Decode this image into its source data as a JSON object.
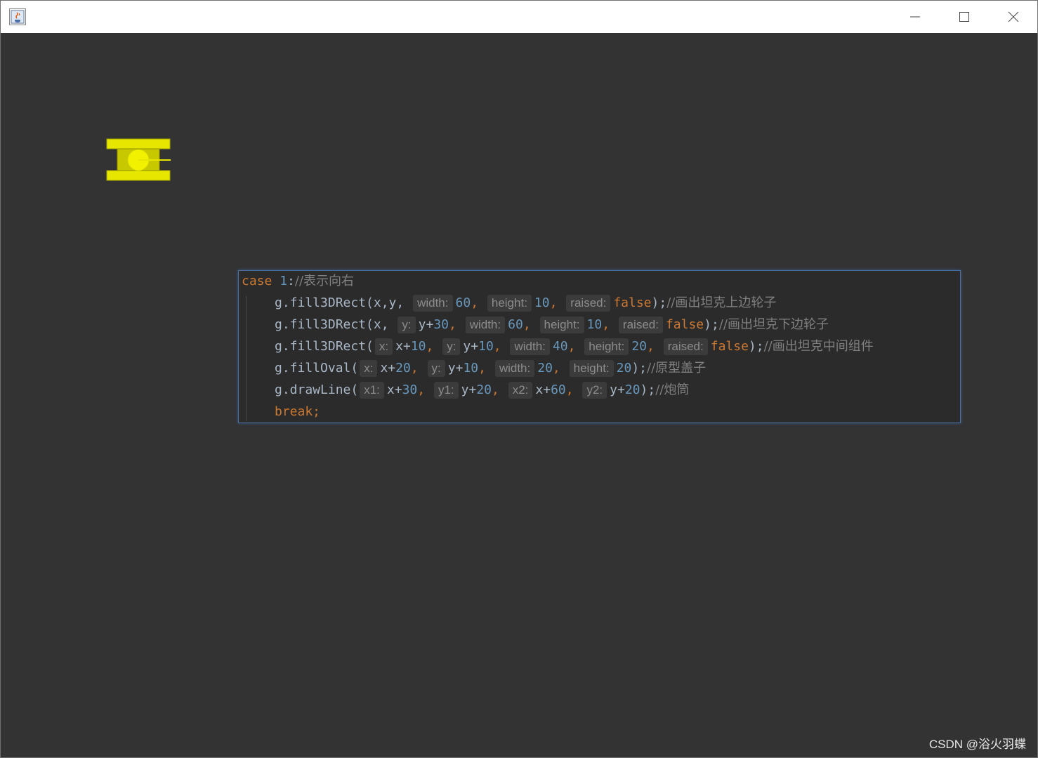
{
  "window": {
    "title": "",
    "icon": "java-coffee-icon",
    "controls": [
      "minimize-icon",
      "maximize-icon",
      "close-icon"
    ]
  },
  "colors": {
    "canvas_bg": "#333333",
    "tank_yellow": "#e6e600",
    "tank_dark": "#b8b800",
    "code_bg": "#2b2b2b",
    "keyword": "#cc7832",
    "number": "#6897bb",
    "comment": "#808080"
  },
  "code": {
    "l1": {
      "kw": "case",
      "num": "1",
      "colon": ":",
      "comment": "//表示向右"
    },
    "l2": {
      "call": "g.fill3DRect(x,y,",
      "h_width": "width:",
      "v_width": "60",
      "sep1": ",",
      "h_height": "height:",
      "v_height": "10",
      "sep2": ",",
      "h_raised": "raised:",
      "v_raised": "false",
      "end": ");",
      "comment": "//画出坦克上边轮子"
    },
    "l3": {
      "call": "g.fill3DRect(x,",
      "h_y": "y:",
      "v_y_a": "y+",
      "v_y_b": "30",
      "sep0": ",",
      "h_width": "width:",
      "v_width": "60",
      "sep1": ",",
      "h_height": "height:",
      "v_height": "10",
      "sep2": ",",
      "h_raised": "raised:",
      "v_raised": "false",
      "end": ");",
      "comment": "//画出坦克下边轮子"
    },
    "l4": {
      "call": "g.fill3DRect(",
      "h_x": "x:",
      "v_x_a": "x+",
      "v_x_b": "10",
      "sepx": ",",
      "h_y": "y:",
      "v_y_a": "y+",
      "v_y_b": "10",
      "sep0": ",",
      "h_width": "width:",
      "v_width": "40",
      "sep1": ",",
      "h_height": "height:",
      "v_height": "20",
      "sep2": ",",
      "h_raised": "raised:",
      "v_raised": "false",
      "end": ");",
      "comment": "//画出坦克中间组件"
    },
    "l5": {
      "call": "g.fillOval(",
      "h_x": "x:",
      "v_x_a": "x+",
      "v_x_b": "20",
      "sepx": ",",
      "h_y": "y:",
      "v_y_a": "y+",
      "v_y_b": "10",
      "sep0": ",",
      "h_width": "width:",
      "v_width": "20",
      "sep1": ",",
      "h_height": "height:",
      "v_height": "20",
      "end": ");",
      "comment": "//原型盖子"
    },
    "l6": {
      "call": "g.drawLine(",
      "h_x1": "x1:",
      "v_x1_a": "x+",
      "v_x1_b": "30",
      "s1": ",",
      "h_y1": "y1:",
      "v_y1_a": "y+",
      "v_y1_b": "20",
      "s2": ",",
      "h_x2": "x2:",
      "v_x2_a": "x+",
      "v_x2_b": "60",
      "s3": ",",
      "h_y2": "y2:",
      "v_y2_a": "y+",
      "v_y2_b": "20",
      "end": ");",
      "comment": "//炮筒"
    },
    "l7": {
      "kw": "break;"
    }
  },
  "watermark": "CSDN @浴火羽蝶"
}
